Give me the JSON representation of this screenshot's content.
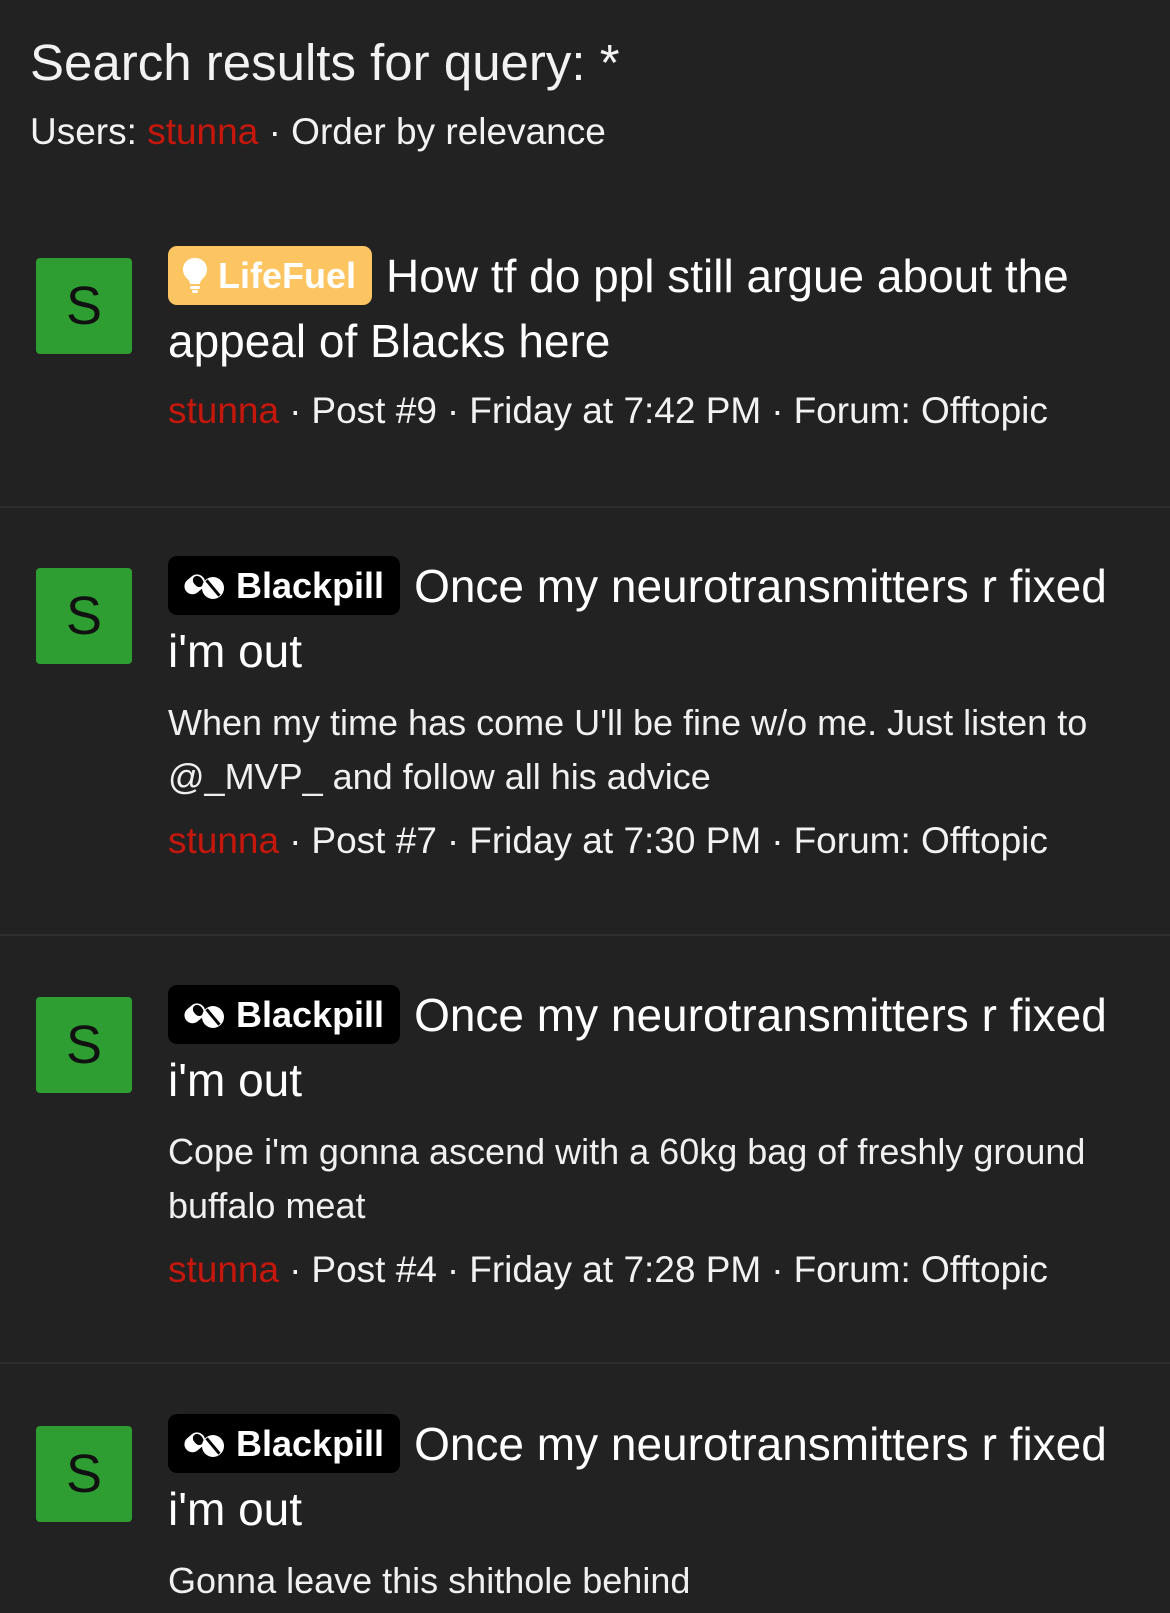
{
  "header": {
    "title": "Search results for query: *",
    "users_label": "Users:",
    "user": "stunna",
    "order": "Order by relevance",
    "separator": "·"
  },
  "colors": {
    "background": "#222222",
    "user_link": "#c6170d",
    "avatar": "#2e9e32",
    "badge_lifefuel": "#fdc561",
    "badge_blackpill": "#000000"
  },
  "results": [
    {
      "avatar_letter": "S",
      "badge": {
        "label": "LifeFuel",
        "icon": "lightbulb-icon"
      },
      "title": "How tf do ppl still argue about the appeal of Blacks here",
      "snippet": "",
      "author": "stunna",
      "post": "Post #9",
      "date": "Friday at 7:42 PM",
      "forum": "Forum: Offtopic"
    },
    {
      "avatar_letter": "S",
      "badge": {
        "label": "Blackpill",
        "icon": "pills-icon"
      },
      "title": "Once my neurotransmitters r fixed i'm out",
      "snippet": "When my time has come U'll be fine w/o me. Just listen to @_MVP_ and follow all his advice",
      "author": "stunna",
      "post": "Post #7",
      "date": "Friday at 7:30 PM",
      "forum": "Forum: Offtopic"
    },
    {
      "avatar_letter": "S",
      "badge": {
        "label": "Blackpill",
        "icon": "pills-icon"
      },
      "title": "Once my neurotransmitters r fixed i'm out",
      "snippet": "Cope i'm gonna ascend with a 60kg bag of freshly ground buffalo meat",
      "author": "stunna",
      "post": "Post #4",
      "date": "Friday at 7:28 PM",
      "forum": "Forum: Offtopic"
    },
    {
      "avatar_letter": "S",
      "badge": {
        "label": "Blackpill",
        "icon": "pills-icon"
      },
      "title": "Once my neurotransmitters r fixed i'm out",
      "snippet": "Gonna leave this shithole behind",
      "author": "",
      "post": "",
      "date": "",
      "forum": ""
    }
  ]
}
